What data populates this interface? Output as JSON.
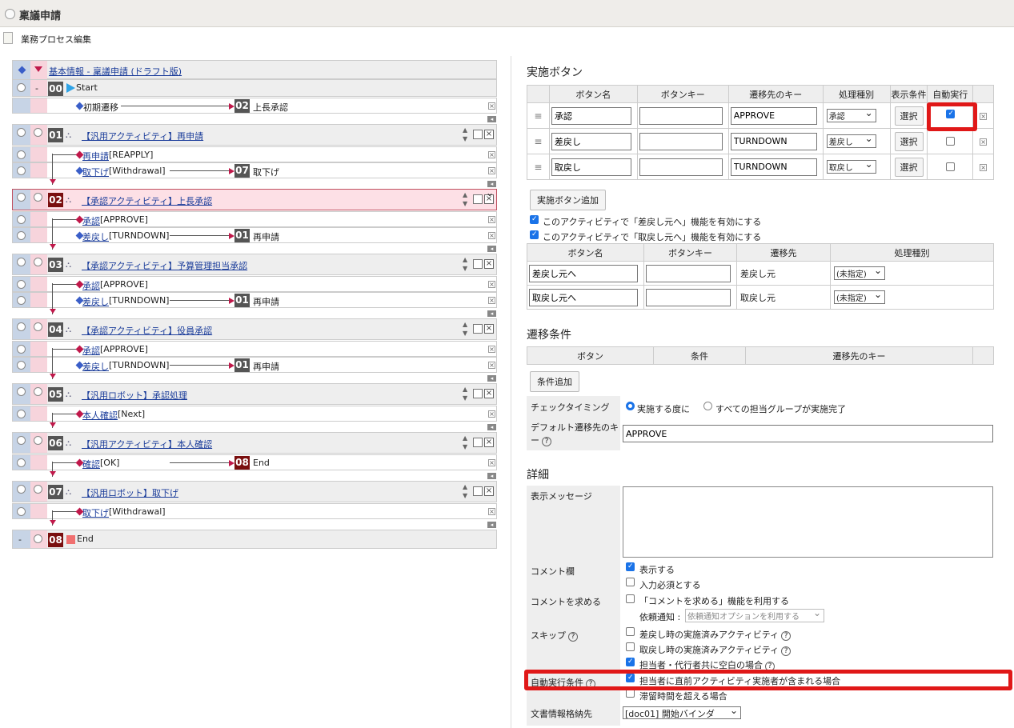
{
  "window": {
    "title": "稟議申請",
    "subtitle": "業務プロセス編集"
  },
  "flow": {
    "header_link": "基本情報 - 稟議申請 (ドラフト版)",
    "start": {
      "num": "00",
      "label": "Start",
      "transition": "初期遷移",
      "target_num": "02",
      "target_label": "上長承認"
    },
    "activities": [
      {
        "num": "01",
        "label": "【汎用アクティビティ】再申請",
        "buttons": [
          {
            "label": "再申請",
            "key": "[REAPPLY]"
          },
          {
            "label": "取下げ",
            "key": "[Withdrawal]",
            "target_num": "07",
            "target_label": "取下げ"
          }
        ]
      },
      {
        "num": "02",
        "label": "【承認アクティビティ】上長承認",
        "buttons": [
          {
            "label": "承認",
            "key": "[APPROVE]"
          },
          {
            "label": "差戻し",
            "key": "[TURNDOWN]",
            "target_num": "01",
            "target_label": "再申請"
          }
        ]
      },
      {
        "num": "03",
        "label": "【承認アクティビティ】予算管理担当承認",
        "buttons": [
          {
            "label": "承認",
            "key": "[APPROVE]"
          },
          {
            "label": "差戻し",
            "key": "[TURNDOWN]",
            "target_num": "01",
            "target_label": "再申請"
          }
        ]
      },
      {
        "num": "04",
        "label": "【承認アクティビティ】役員承認",
        "buttons": [
          {
            "label": "承認",
            "key": "[APPROVE]"
          },
          {
            "label": "差戻し",
            "key": "[TURNDOWN]",
            "target_num": "01",
            "target_label": "再申請"
          }
        ]
      },
      {
        "num": "05",
        "label": "【汎用ロボット】承認処理",
        "buttons": [
          {
            "label": "本人確認",
            "key": "[Next]"
          }
        ]
      },
      {
        "num": "06",
        "label": "【汎用アクティビティ】本人確認",
        "buttons": [
          {
            "label": "確認",
            "key": "[OK]",
            "target_num": "08",
            "target_label": "End"
          }
        ]
      },
      {
        "num": "07",
        "label": "【汎用ロボット】取下げ",
        "buttons": [
          {
            "label": "取下げ",
            "key": "[Withdrawal]"
          }
        ]
      }
    ],
    "end": {
      "num": "08",
      "label": "End"
    }
  },
  "buttons_section": {
    "title": "実施ボタン",
    "headers": [
      "ボタン名",
      "ボタンキー",
      "遷移先のキー",
      "処理種別",
      "表示条件",
      "自動実行"
    ],
    "rows": [
      {
        "name": "承認",
        "key": "",
        "dest": "APPROVE",
        "type": "承認",
        "select": "選択",
        "auto": true
      },
      {
        "name": "差戻し",
        "key": "",
        "dest": "TURNDOWN",
        "type": "差戻し",
        "select": "選択",
        "auto": false
      },
      {
        "name": "取戻し",
        "key": "",
        "dest": "TURNDOWN",
        "type": "取戻し",
        "select": "選択",
        "auto": false
      }
    ],
    "add_button": "実施ボタン追加",
    "opt1": "このアクティビティで「差戻し元へ」機能を有効にする",
    "opt2": "このアクティビティで「取戻し元へ」機能を有効にする",
    "headers2": [
      "ボタン名",
      "ボタンキー",
      "遷移先",
      "処理種別"
    ],
    "rows2": [
      {
        "name": "差戻し元へ",
        "key": "",
        "dest": "差戻し元",
        "type": "(未指定)"
      },
      {
        "name": "取戻し元へ",
        "key": "",
        "dest": "取戻し元",
        "type": "(未指定)"
      }
    ]
  },
  "transition": {
    "title": "遷移条件",
    "headers": [
      "ボタン",
      "条件",
      "遷移先のキー"
    ],
    "add_button": "条件追加",
    "timing_label": "チェックタイミング",
    "timing_opt1": "実施する度に",
    "timing_opt2": "すべての担当グループが実施完了",
    "default_label": "デフォルト遷移先のキー",
    "default_value": "APPROVE"
  },
  "detail": {
    "title": "詳細",
    "message_label": "表示メッセージ",
    "comment_label": "コメント欄",
    "comment_show": "表示する",
    "comment_required": "入力必須とする",
    "request_label": "コメントを求める",
    "request_opt": "「コメントを求める」機能を利用する",
    "notify_label": "依頼通知 :",
    "notify_value": "依頼通知オプションを利用する",
    "skip_label": "スキップ",
    "skip1": "差戻し時の実施済みアクティビティ",
    "skip2": "取戻し時の実施済みアクティビティ",
    "skip3": "担当者・代行者共に空白の場合",
    "auto_label": "自動実行条件",
    "auto1": "担当者に直前アクティビティ実施者が含まれる場合",
    "auto2": "滞留時間を超える場合",
    "doc_label": "文書情報格納先",
    "doc_value": "[doc01] 開始バインダ"
  },
  "colors": {
    "accent_red": "#e01818",
    "link": "#1a3c9a",
    "dark_num": "#7a0f0f"
  }
}
